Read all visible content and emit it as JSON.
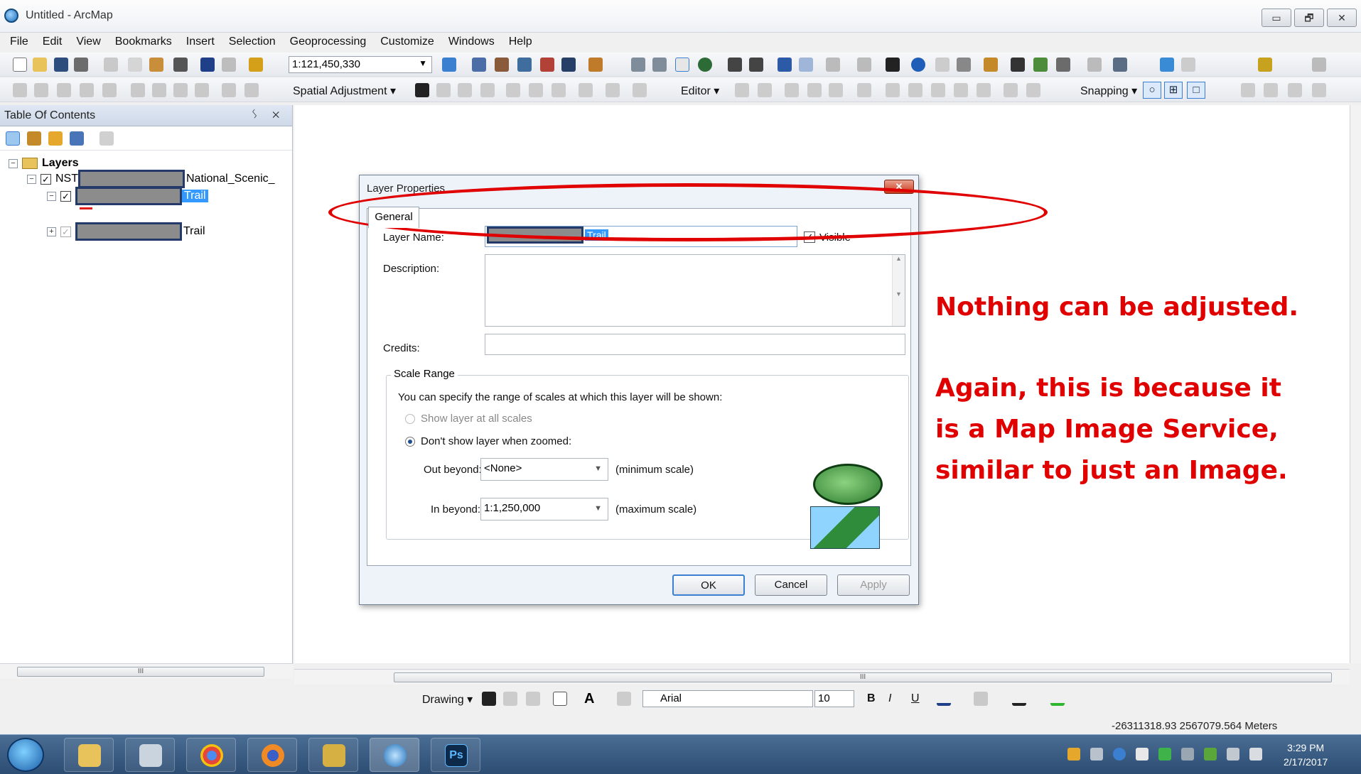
{
  "window": {
    "title": "Untitled - ArcMap",
    "controls": [
      "▭",
      "🗗",
      "✕"
    ]
  },
  "menu": [
    "File",
    "Edit",
    "View",
    "Bookmarks",
    "Insert",
    "Selection",
    "Geoprocessing",
    "Customize",
    "Windows",
    "Help"
  ],
  "toolbar": {
    "scale": "1:121,450,330",
    "spatial_adjustment": "Spatial Adjustment ▾",
    "editor": "Editor ▾",
    "snapping": "Snapping ▾"
  },
  "toc": {
    "title": "Table Of Contents",
    "pin_close": "ᛊ ✕",
    "layers_label": "Layers",
    "layer1_prefix": "NST",
    "layer1_suffix": "National_Scenic_",
    "sublayer1_suffix": "Trail",
    "sublayer2_suffix": "Trail",
    "scroll_grip": "III"
  },
  "dialog": {
    "title": "Layer Properties",
    "close": "✕",
    "tab": "General",
    "layer_name_label": "Layer Name:",
    "layer_name_value": "Trail",
    "visible_label": "Visible",
    "description_label": "Description:",
    "credits_label": "Credits:",
    "scale_range_title": "Scale Range",
    "scale_range_text": "You can specify the range of scales at which this layer will be shown:",
    "show_all": "Show layer at all scales",
    "dont_show": "Don't show layer when zoomed:",
    "out_beyond_label": "Out beyond:",
    "out_beyond_value": "<None>",
    "out_beyond_hint": "(minimum scale)",
    "in_beyond_label": "In beyond:",
    "in_beyond_value": "1:1,250,000",
    "in_beyond_hint": "(maximum scale)",
    "ok": "OK",
    "cancel": "Cancel",
    "apply": "Apply"
  },
  "annotation": {
    "line1": "Nothing can be adjusted.",
    "line2": "Again, this is because it",
    "line3": "is a Map Image Service,",
    "line4": "similar to just an Image.",
    "color": "#e00000"
  },
  "map_scroll_grip": "III",
  "drawing": {
    "label": "Drawing ▾",
    "font": "Arial",
    "size": "10",
    "bold": "B",
    "italic": "I",
    "underline": "U"
  },
  "status": {
    "coordinates": "-26311318.93  2567079.564 Meters"
  },
  "taskbar": {
    "ps_label": "Ps",
    "time": "3:29 PM",
    "date": "2/17/2017"
  }
}
